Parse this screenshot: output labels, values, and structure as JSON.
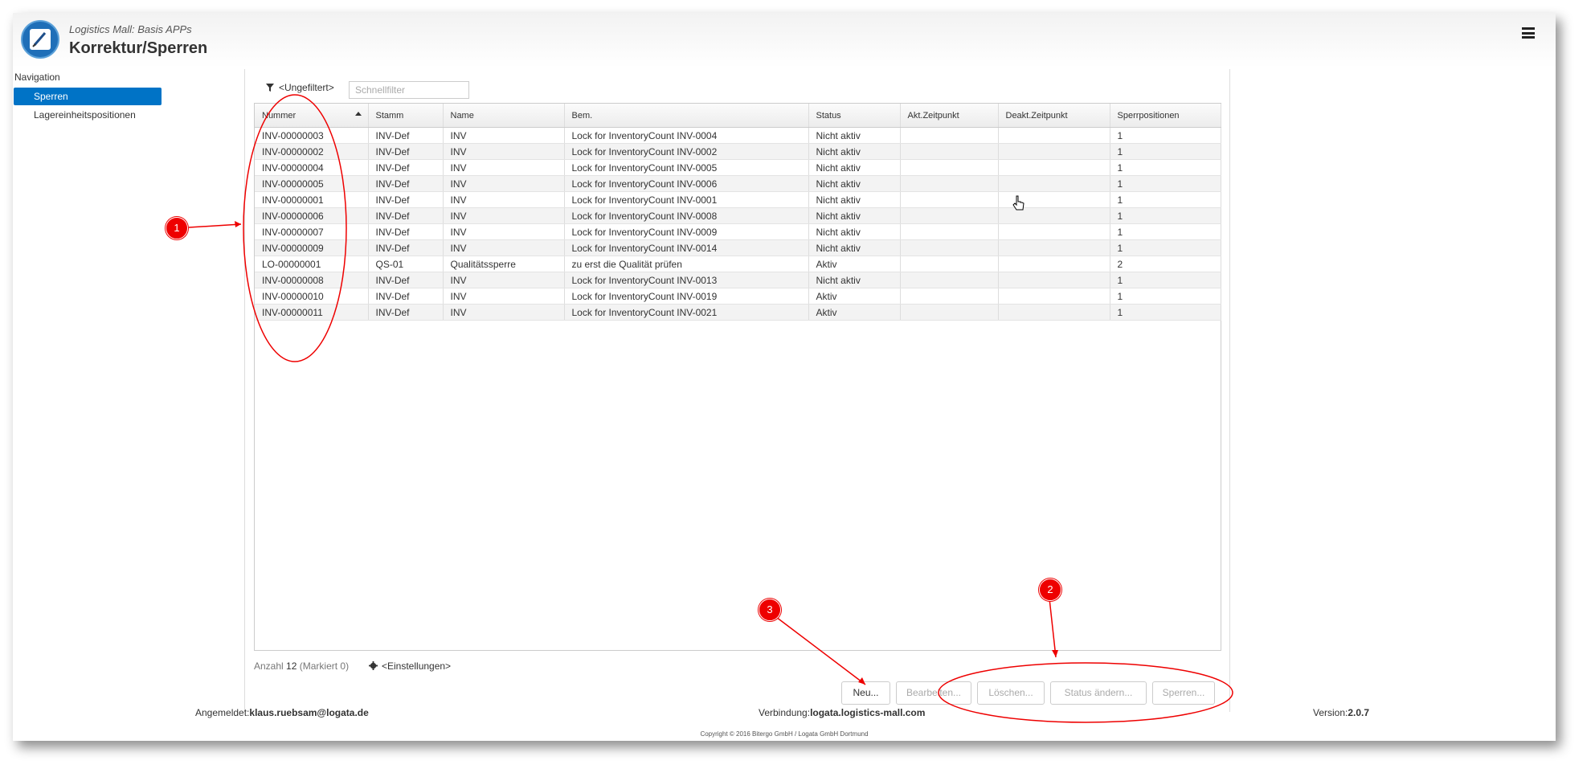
{
  "header": {
    "app_subtitle": "Logistics Mall: Basis APPs",
    "app_title": "Korrektur/Sperren"
  },
  "navigation": {
    "label": "Navigation",
    "items": [
      {
        "label": "Sperren",
        "active": true
      },
      {
        "label": "Lagereinheitspositionen",
        "active": false
      }
    ]
  },
  "filter": {
    "label": "<Ungefiltert>",
    "quickfilter_placeholder": "Schnellfilter"
  },
  "table": {
    "columns": [
      "Nummer",
      "Stamm",
      "Name",
      "Bem.",
      "Status",
      "Akt.Zeitpunkt",
      "Deakt.Zeitpunkt",
      "Sperrpositionen"
    ],
    "rows": [
      [
        "INV-00000003",
        "INV-Def",
        "INV",
        "Lock for InventoryCount INV-0004",
        "Nicht aktiv",
        "",
        "",
        "1"
      ],
      [
        "INV-00000002",
        "INV-Def",
        "INV",
        "Lock for InventoryCount INV-0002",
        "Nicht aktiv",
        "",
        "",
        "1"
      ],
      [
        "INV-00000004",
        "INV-Def",
        "INV",
        "Lock for InventoryCount INV-0005",
        "Nicht aktiv",
        "",
        "",
        "1"
      ],
      [
        "INV-00000005",
        "INV-Def",
        "INV",
        "Lock for InventoryCount INV-0006",
        "Nicht aktiv",
        "",
        "",
        "1"
      ],
      [
        "INV-00000001",
        "INV-Def",
        "INV",
        "Lock for InventoryCount INV-0001",
        "Nicht aktiv",
        "",
        "",
        "1"
      ],
      [
        "INV-00000006",
        "INV-Def",
        "INV",
        "Lock for InventoryCount INV-0008",
        "Nicht aktiv",
        "",
        "",
        "1"
      ],
      [
        "INV-00000007",
        "INV-Def",
        "INV",
        "Lock for InventoryCount INV-0009",
        "Nicht aktiv",
        "",
        "",
        "1"
      ],
      [
        "INV-00000009",
        "INV-Def",
        "INV",
        "Lock for InventoryCount INV-0014",
        "Nicht aktiv",
        "",
        "",
        "1"
      ],
      [
        "LO-00000001",
        "QS-01",
        "Qualitätssperre",
        "zu erst die Qualität prüfen",
        "Aktiv",
        "",
        "",
        "2"
      ],
      [
        "INV-00000008",
        "INV-Def",
        "INV",
        "Lock for InventoryCount INV-0013",
        "Nicht aktiv",
        "",
        "",
        "1"
      ],
      [
        "INV-00000010",
        "INV-Def",
        "INV",
        "Lock for InventoryCount INV-0019",
        "Aktiv",
        "",
        "",
        "1"
      ],
      [
        "INV-00000011",
        "INV-Def",
        "INV",
        "Lock for InventoryCount INV-0021",
        "Aktiv",
        "",
        "",
        "1"
      ]
    ]
  },
  "footer": {
    "count_label": "Anzahl",
    "count_value": "12",
    "marked": "(Markiert 0)",
    "settings_label": "<Einstellungen>"
  },
  "buttons": {
    "new": "Neu...",
    "edit": "Bearbeiten...",
    "delete": "Löschen...",
    "change_status": "Status ändern...",
    "lock": "Sperren..."
  },
  "status_bar": {
    "logged_in_label": "Angemeldet:",
    "logged_in_user": "klaus.ruebsam@logata.de",
    "connection_label": "Verbindung:",
    "connection_value": "logata.logistics-mall.com",
    "version_label": "Version:",
    "version_value": "2.0.7",
    "copyright": "Copyright © 2016 Bitergo GmbH / Logata GmbH Dortmund"
  },
  "annotations": {
    "callout_1": "1",
    "callout_2": "2",
    "callout_3": "3",
    "color": "#e00000"
  },
  "colors": {
    "accent": "#0073c6"
  }
}
